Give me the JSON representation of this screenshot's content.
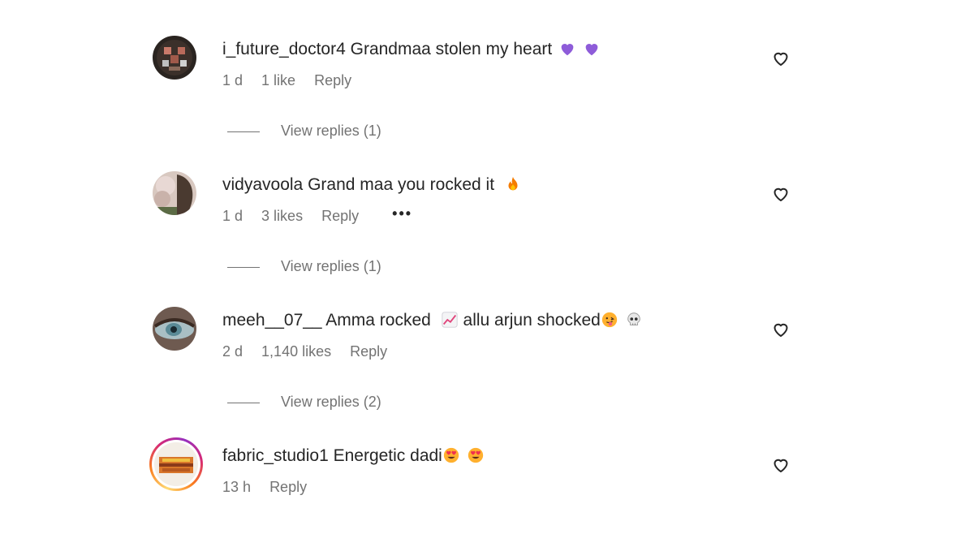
{
  "comments": [
    {
      "username": "i_future_doctor4",
      "text": "Grandmaa stolen my heart",
      "emojis": [
        "purple-heart",
        "purple-heart"
      ],
      "time": "1 d",
      "likes": "1 like",
      "reply_label": "Reply",
      "view_replies": "View replies (1)"
    },
    {
      "username": "vidyavoola",
      "text": "Grand maa you rocked it",
      "emojis": [
        "fire"
      ],
      "time": "1 d",
      "likes": "3 likes",
      "reply_label": "Reply",
      "more": "•••",
      "view_replies": "View replies (1)"
    },
    {
      "username": "meeh__07__",
      "text": "Amma rocked",
      "text2": "allu arjun shocked",
      "emojis": [
        "chart-increasing",
        "face-with-tongue",
        "skull"
      ],
      "time": "2 d",
      "likes": "1,140 likes",
      "reply_label": "Reply",
      "view_replies": "View replies (2)"
    },
    {
      "username": "fabric_studio1",
      "text": "Energetic dadi",
      "emojis": [
        "heart-eyes",
        "heart-eyes"
      ],
      "time": "13 h",
      "reply_label": "Reply"
    }
  ],
  "colors": {
    "text": "#262626",
    "muted": "#737373",
    "purple_heart": "#8e5cd9",
    "fire": "#f57c00"
  }
}
